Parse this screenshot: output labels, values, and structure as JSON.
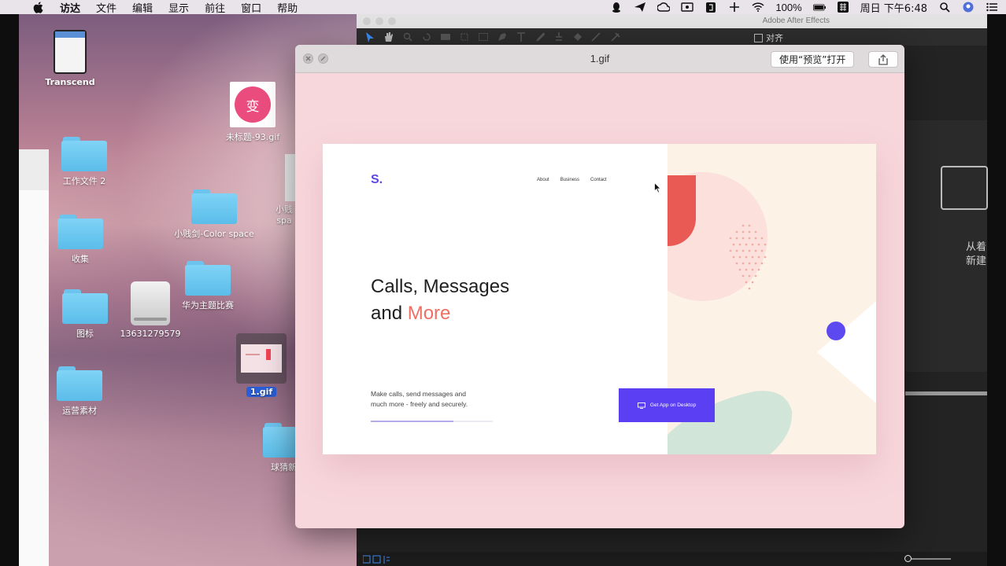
{
  "menubar": {
    "app_name": "访达",
    "menus": [
      "文件",
      "编辑",
      "显示",
      "前往",
      "窗口",
      "帮助"
    ],
    "battery": "100%",
    "clock": "周日 下午6:48"
  },
  "desktop": {
    "icons": {
      "transcend": "Transcend",
      "gif93": "未标题-93.gif",
      "gif93_badge": "变",
      "workfile2": "工作文件 2",
      "colorspace": "小贱剑-Color space",
      "collect": "收集",
      "huawei": "华为主题比赛",
      "drive": "13631279579",
      "icons_folder": "图标",
      "gif1": "1.gif",
      "ops": "运营素材",
      "partial1": "小贱",
      "partial1b": "spa",
      "partial2": "球猜新"
    }
  },
  "after_effects": {
    "title": "Adobe After Effects",
    "align_label": "对齐",
    "right_text_line1": "从着",
    "right_text_line2": "新建"
  },
  "quicklook": {
    "title": "1.gif",
    "open_button": "使用“预览”打开"
  },
  "preview": {
    "logo": "S.",
    "nav": [
      "About",
      "Business",
      "Contact"
    ],
    "headline_line1": "Calls, Messages",
    "headline_and": "and ",
    "headline_accent": "More",
    "subtext_line1": "Make calls, send messages and",
    "subtext_line2": "much more - freely and securely.",
    "cta_label": "Get App on Desktop",
    "progress": 0.68,
    "colors": {
      "brand": "#5b47e6",
      "accent": "#ef6f63",
      "cta": "#5b3ff2",
      "background": "#f7d7dc"
    }
  }
}
